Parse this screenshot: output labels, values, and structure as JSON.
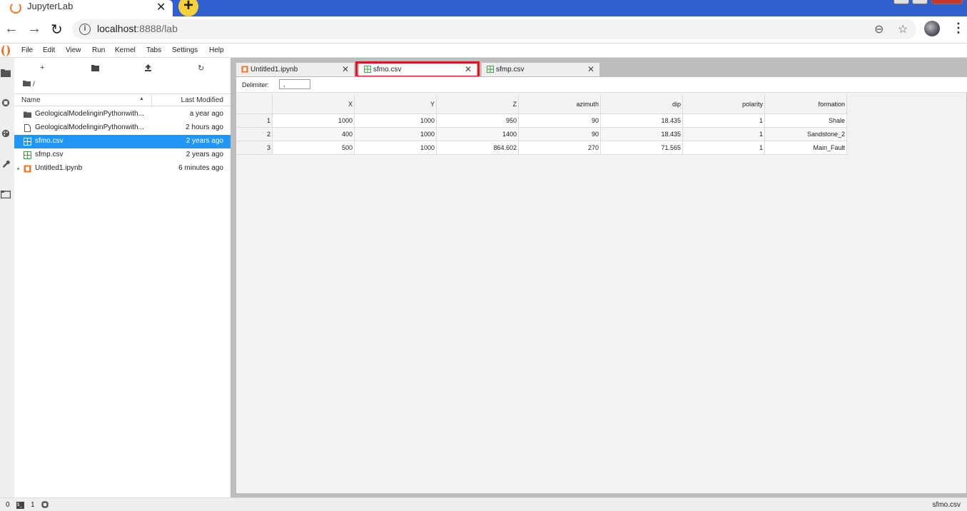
{
  "browser": {
    "tab_title": "JupyterLab",
    "url_host": "localhost",
    "url_port_path": ":8888/lab"
  },
  "menubar": {
    "items": [
      "File",
      "Edit",
      "View",
      "Run",
      "Kernel",
      "Tabs",
      "Settings",
      "Help"
    ]
  },
  "filebrowser": {
    "breadcrumb": "/",
    "col_name": "Name",
    "col_modified": "Last Modified",
    "files": [
      {
        "name": "GeologicalModelinginPythonwith...",
        "modified": "a year ago",
        "icon": "folder-icon"
      },
      {
        "name": "GeologicalModelinginPythonwith...",
        "modified": "2 hours ago",
        "icon": "file-icon"
      },
      {
        "name": "sfmo.csv",
        "modified": "2 years ago",
        "icon": "spreadsheet-icon"
      },
      {
        "name": "sfmp.csv",
        "modified": "2 years ago",
        "icon": "spreadsheet-icon"
      },
      {
        "name": "Untitled1.ipynb",
        "modified": "6 minutes ago",
        "icon": "notebook-icon"
      }
    ],
    "selected_index": 2
  },
  "doc_tabs": [
    {
      "label": "Untitled1.ipynb",
      "icon": "notebook-icon"
    },
    {
      "label": "sfmo.csv",
      "icon": "spreadsheet-icon"
    },
    {
      "label": "sfmp.csv",
      "icon": "spreadsheet-icon"
    }
  ],
  "active_tab_index": 1,
  "csv_viewer": {
    "delimiter_label": "Delimiter:",
    "delimiter_value": ",",
    "columns": [
      "X",
      "Y",
      "Z",
      "azimuth",
      "dip",
      "polarity",
      "formation"
    ],
    "rows": [
      {
        "index": "1",
        "cells": [
          "1000",
          "1000",
          "950",
          "90",
          "18.435",
          "1",
          "Shale"
        ]
      },
      {
        "index": "2",
        "cells": [
          "400",
          "1000",
          "1400",
          "90",
          "18.435",
          "1",
          "Sandstone_2"
        ]
      },
      {
        "index": "3",
        "cells": [
          "500",
          "1000",
          "864.602",
          "270",
          "71.565",
          "1",
          "Main_Fault"
        ]
      }
    ]
  },
  "statusbar": {
    "kernels": "0",
    "terminals": "1",
    "current_file": "sfmo.csv"
  },
  "colors": {
    "accent": "#2196f3",
    "highlight": "#e0141e",
    "jupyter_orange": "#f37626"
  }
}
